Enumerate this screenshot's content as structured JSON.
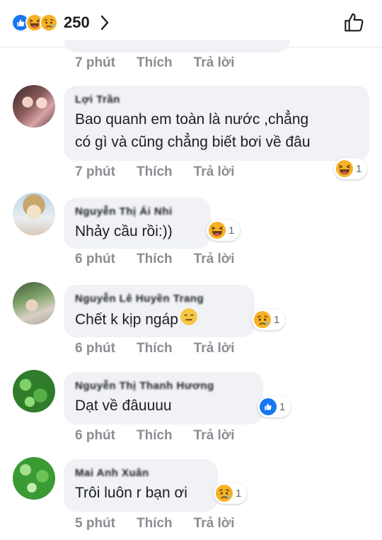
{
  "reactions": {
    "count": "250",
    "icons": [
      "like-icon",
      "haha-icon",
      "sad-icon"
    ]
  },
  "colors": {
    "like_blue": "#1877f2",
    "emoji_yellow": "#f7b125",
    "bubble_bg": "#f0f2f5",
    "meta_gray": "#8a8d91"
  },
  "top_comment": {
    "time": "7 phút",
    "like_label": "Thích",
    "reply_label": "Trả lời"
  },
  "comments": [
    {
      "author": "Lợi Trần",
      "text_lines": [
        "Bao quanh em toàn là nước ,chẳng",
        "có gì và cũng chẳng biết bơi về đâu"
      ],
      "time": "7 phút",
      "like_label": "Thích",
      "reply_label": "Trả lời",
      "reaction": "haha-icon",
      "reaction_count": "1"
    },
    {
      "author": "Nguyễn Thị Ái Nhi",
      "text_lines": [
        "Nhảy cầu rồi:))"
      ],
      "time": "6 phút",
      "like_label": "Thích",
      "reply_label": "Trả lời",
      "reaction": "haha-icon",
      "reaction_count": "1"
    },
    {
      "author": "Nguyễn Lê Huyền Trang",
      "text_lines": [
        "Chết k kịp ngáp"
      ],
      "text_emoji": "neutral-face-icon",
      "time": "6 phút",
      "like_label": "Thích",
      "reply_label": "Trả lời",
      "reaction": "sad-icon",
      "reaction_count": "1"
    },
    {
      "author": "Nguyễn Thị Thanh Hương",
      "text_lines": [
        "Dạt về đâuuuu"
      ],
      "time": "6 phút",
      "like_label": "Thích",
      "reply_label": "Trả lời",
      "reaction": "like-icon",
      "reaction_count": "1"
    },
    {
      "author": "Mai Anh Xuân",
      "text_lines": [
        "Trôi luôn r bạn ơi"
      ],
      "time": "5 phút",
      "like_label": "Thích",
      "reply_label": "Trả lời",
      "reaction": "sad-icon",
      "reaction_count": "1"
    }
  ]
}
